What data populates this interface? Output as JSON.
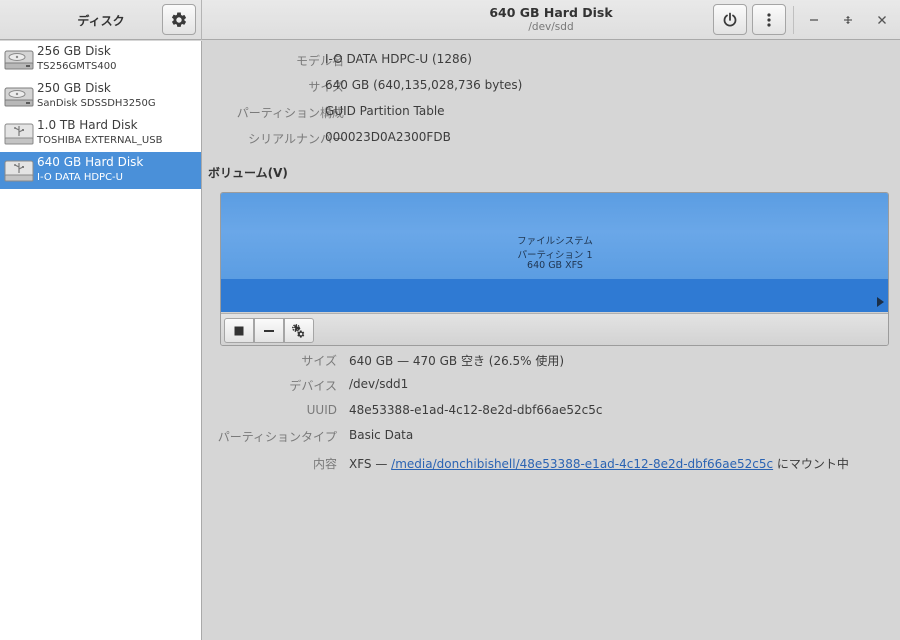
{
  "sidebar": {
    "title": "ディスク",
    "disks": [
      {
        "name": "256 GB Disk",
        "model": "TS256GMTS400",
        "icon": "harddisk-icon"
      },
      {
        "name": "250 GB Disk",
        "model": "SanDisk SDSSDH3250G",
        "icon": "harddisk-icon"
      },
      {
        "name": "1.0 TB Hard Disk",
        "model": "TOSHIBA EXTERNAL_USB",
        "icon": "usb-harddisk-icon"
      },
      {
        "name": "640 GB Hard Disk",
        "model": "I-O DATA HDPC-U",
        "icon": "usb-harddisk-icon",
        "selected": true
      }
    ]
  },
  "header": {
    "title": "640 GB Hard Disk",
    "subtitle": "/dev/sdd"
  },
  "drive": {
    "model_label": "モデル名",
    "model_value": "I-O DATA HDPC-U (1286)",
    "size_label": "サイズ",
    "size_value": "640 GB (640,135,028,736 bytes)",
    "partitioning_label": "パーティション構成",
    "partitioning_value": "GUID Partition Table",
    "serial_label": "シリアルナンバー",
    "serial_value": "000023D0A2300FDB"
  },
  "volumes": {
    "heading": "ボリューム(V)",
    "block": {
      "line1": "ファイルシステム",
      "line2": "パーティション 1",
      "line3": "640 GB XFS"
    }
  },
  "partition": {
    "size_label": "サイズ",
    "size_value": "640 GB — 470 GB 空き (26.5% 使用)",
    "device_label": "デバイス",
    "device_value": "/dev/sdd1",
    "uuid_label": "UUID",
    "uuid_value": "48e53388-e1ad-4c12-8e2d-dbf66ae52c5c",
    "type_label": "パーティションタイプ",
    "type_value": "Basic Data",
    "contents_label": "内容",
    "contents_prefix": "XFS — ",
    "contents_link": "/media/donchibishell/48e53388-e1ad-4c12-8e2d-dbf66ae52c5c",
    "contents_suffix": " にマウント中"
  },
  "colors": {
    "selection": "#4a90d9",
    "partition_fill": "#5b9de2",
    "partition_bar": "#2f7ad3",
    "link": "#2a63b3"
  }
}
